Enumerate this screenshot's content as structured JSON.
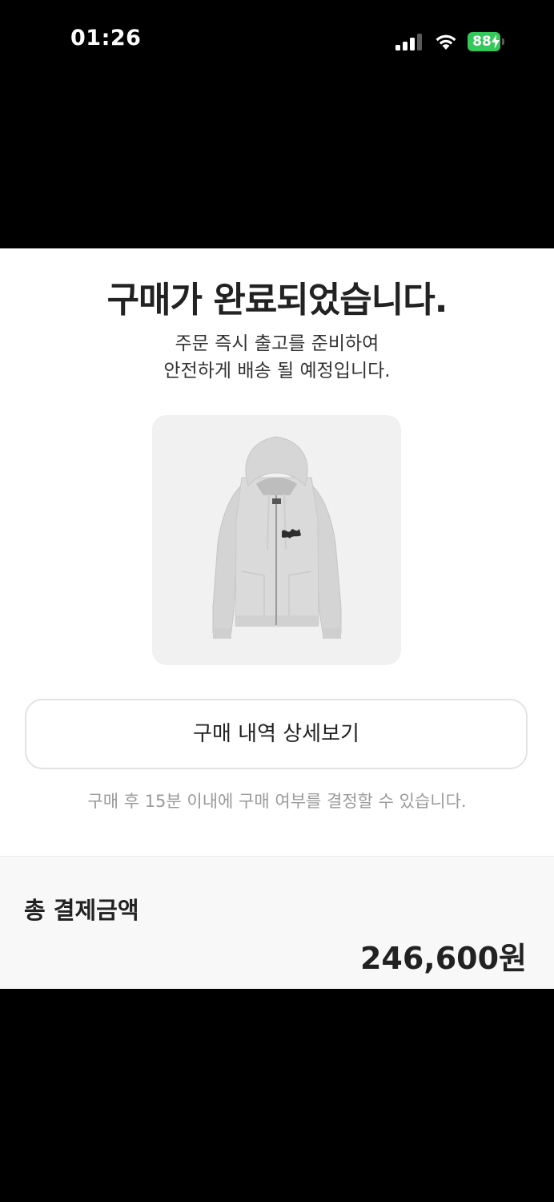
{
  "status_bar": {
    "time": "01:26",
    "battery": "88"
  },
  "confirmation": {
    "title": "구매가 완료되었습니다.",
    "subtitle_line1": "주문 즉시 출고를 준비하여",
    "subtitle_line2": "안전하게 배송 될 예정입니다."
  },
  "product": {
    "image_icon": "zip-hoodie-image",
    "logo_text": "Stüssy"
  },
  "actions": {
    "detail_button_label": "구매 내역 상세보기"
  },
  "notice": "구매 후 15분 이내에 구매 여부를 결정할 수 있습니다.",
  "payment": {
    "label": "총 결제금액",
    "amount": "246,600원"
  },
  "colors": {
    "battery": "#34c759",
    "sheet_background": "#ffffff",
    "payment_background": "#f8f8f8",
    "text_primary": "#222222",
    "text_muted": "#9a9a9a"
  }
}
